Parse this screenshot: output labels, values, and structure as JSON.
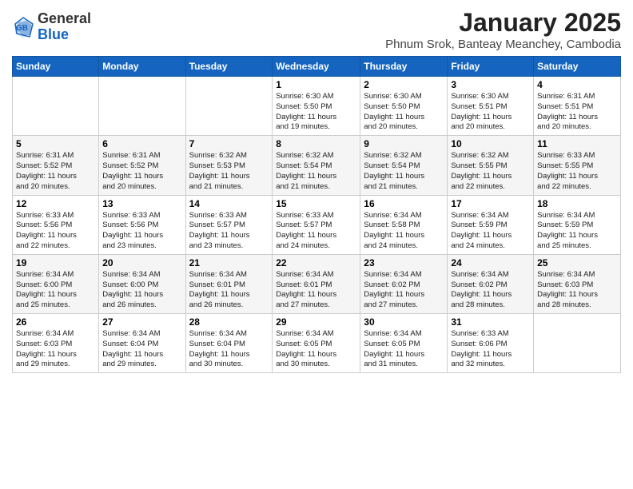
{
  "header": {
    "logo_general": "General",
    "logo_blue": "Blue",
    "title": "January 2025",
    "subtitle": "Phnum Srok, Banteay Meanchey, Cambodia"
  },
  "calendar": {
    "days_of_week": [
      "Sunday",
      "Monday",
      "Tuesday",
      "Wednesday",
      "Thursday",
      "Friday",
      "Saturday"
    ],
    "weeks": [
      [
        {
          "day": "",
          "info": ""
        },
        {
          "day": "",
          "info": ""
        },
        {
          "day": "",
          "info": ""
        },
        {
          "day": "1",
          "info": "Sunrise: 6:30 AM\nSunset: 5:50 PM\nDaylight: 11 hours\nand 19 minutes."
        },
        {
          "day": "2",
          "info": "Sunrise: 6:30 AM\nSunset: 5:50 PM\nDaylight: 11 hours\nand 20 minutes."
        },
        {
          "day": "3",
          "info": "Sunrise: 6:30 AM\nSunset: 5:51 PM\nDaylight: 11 hours\nand 20 minutes."
        },
        {
          "day": "4",
          "info": "Sunrise: 6:31 AM\nSunset: 5:51 PM\nDaylight: 11 hours\nand 20 minutes."
        }
      ],
      [
        {
          "day": "5",
          "info": "Sunrise: 6:31 AM\nSunset: 5:52 PM\nDaylight: 11 hours\nand 20 minutes."
        },
        {
          "day": "6",
          "info": "Sunrise: 6:31 AM\nSunset: 5:52 PM\nDaylight: 11 hours\nand 20 minutes."
        },
        {
          "day": "7",
          "info": "Sunrise: 6:32 AM\nSunset: 5:53 PM\nDaylight: 11 hours\nand 21 minutes."
        },
        {
          "day": "8",
          "info": "Sunrise: 6:32 AM\nSunset: 5:54 PM\nDaylight: 11 hours\nand 21 minutes."
        },
        {
          "day": "9",
          "info": "Sunrise: 6:32 AM\nSunset: 5:54 PM\nDaylight: 11 hours\nand 21 minutes."
        },
        {
          "day": "10",
          "info": "Sunrise: 6:32 AM\nSunset: 5:55 PM\nDaylight: 11 hours\nand 22 minutes."
        },
        {
          "day": "11",
          "info": "Sunrise: 6:33 AM\nSunset: 5:55 PM\nDaylight: 11 hours\nand 22 minutes."
        }
      ],
      [
        {
          "day": "12",
          "info": "Sunrise: 6:33 AM\nSunset: 5:56 PM\nDaylight: 11 hours\nand 22 minutes."
        },
        {
          "day": "13",
          "info": "Sunrise: 6:33 AM\nSunset: 5:56 PM\nDaylight: 11 hours\nand 23 minutes."
        },
        {
          "day": "14",
          "info": "Sunrise: 6:33 AM\nSunset: 5:57 PM\nDaylight: 11 hours\nand 23 minutes."
        },
        {
          "day": "15",
          "info": "Sunrise: 6:33 AM\nSunset: 5:57 PM\nDaylight: 11 hours\nand 24 minutes."
        },
        {
          "day": "16",
          "info": "Sunrise: 6:34 AM\nSunset: 5:58 PM\nDaylight: 11 hours\nand 24 minutes."
        },
        {
          "day": "17",
          "info": "Sunrise: 6:34 AM\nSunset: 5:59 PM\nDaylight: 11 hours\nand 24 minutes."
        },
        {
          "day": "18",
          "info": "Sunrise: 6:34 AM\nSunset: 5:59 PM\nDaylight: 11 hours\nand 25 minutes."
        }
      ],
      [
        {
          "day": "19",
          "info": "Sunrise: 6:34 AM\nSunset: 6:00 PM\nDaylight: 11 hours\nand 25 minutes."
        },
        {
          "day": "20",
          "info": "Sunrise: 6:34 AM\nSunset: 6:00 PM\nDaylight: 11 hours\nand 26 minutes."
        },
        {
          "day": "21",
          "info": "Sunrise: 6:34 AM\nSunset: 6:01 PM\nDaylight: 11 hours\nand 26 minutes."
        },
        {
          "day": "22",
          "info": "Sunrise: 6:34 AM\nSunset: 6:01 PM\nDaylight: 11 hours\nand 27 minutes."
        },
        {
          "day": "23",
          "info": "Sunrise: 6:34 AM\nSunset: 6:02 PM\nDaylight: 11 hours\nand 27 minutes."
        },
        {
          "day": "24",
          "info": "Sunrise: 6:34 AM\nSunset: 6:02 PM\nDaylight: 11 hours\nand 28 minutes."
        },
        {
          "day": "25",
          "info": "Sunrise: 6:34 AM\nSunset: 6:03 PM\nDaylight: 11 hours\nand 28 minutes."
        }
      ],
      [
        {
          "day": "26",
          "info": "Sunrise: 6:34 AM\nSunset: 6:03 PM\nDaylight: 11 hours\nand 29 minutes."
        },
        {
          "day": "27",
          "info": "Sunrise: 6:34 AM\nSunset: 6:04 PM\nDaylight: 11 hours\nand 29 minutes."
        },
        {
          "day": "28",
          "info": "Sunrise: 6:34 AM\nSunset: 6:04 PM\nDaylight: 11 hours\nand 30 minutes."
        },
        {
          "day": "29",
          "info": "Sunrise: 6:34 AM\nSunset: 6:05 PM\nDaylight: 11 hours\nand 30 minutes."
        },
        {
          "day": "30",
          "info": "Sunrise: 6:34 AM\nSunset: 6:05 PM\nDaylight: 11 hours\nand 31 minutes."
        },
        {
          "day": "31",
          "info": "Sunrise: 6:33 AM\nSunset: 6:06 PM\nDaylight: 11 hours\nand 32 minutes."
        },
        {
          "day": "",
          "info": ""
        }
      ]
    ]
  }
}
